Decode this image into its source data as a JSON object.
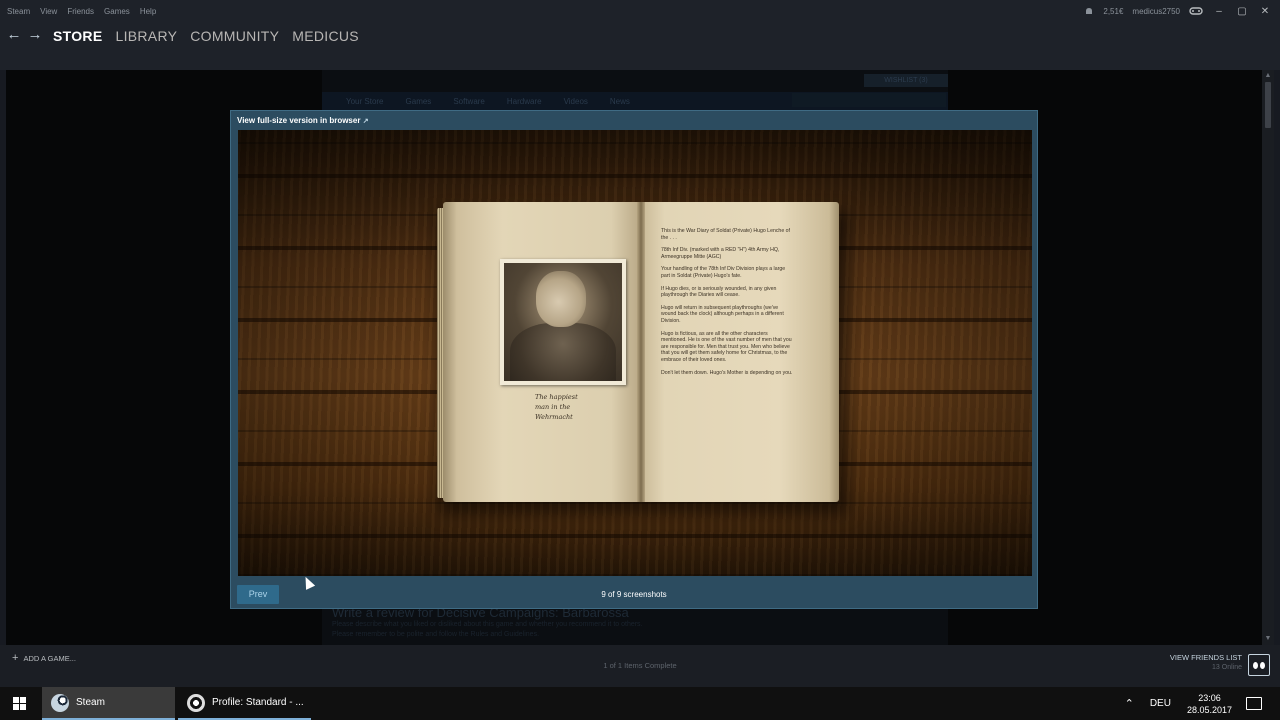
{
  "menu": {
    "items": [
      "Steam",
      "View",
      "Friends",
      "Games",
      "Help"
    ],
    "wallet": "2,51€",
    "username": "medicus2750"
  },
  "nav": {
    "back": "←",
    "forward": "→",
    "store": "STORE",
    "library": "LIBRARY",
    "community": "COMMUNITY",
    "profile": "MEDICUS"
  },
  "store_bg": {
    "nav_items": [
      "Your Store",
      "Games",
      "Software",
      "Hardware",
      "Videos",
      "News"
    ],
    "wishlist": "WISHLIST (3)",
    "review_title": "Write a review for Decisive Campaigns: Barbarossa",
    "review_text1": "Please describe what you liked or disliked about this game and whether you recommend it to others.",
    "review_text2": "Please remember to be polite and follow the Rules and Guidelines."
  },
  "modal": {
    "view_full": "View full-size version in browser",
    "ext_icon": "↗",
    "prev": "Prev",
    "counter": "9 of 9 screenshots",
    "caption": [
      "The happiest",
      "man in the",
      "Wehrmacht"
    ],
    "diary": [
      "This is the War Diary of Soldat (Private) Hugo Lenche of the . . .",
      "78th Inf Div. (marked with a RED \"H\") 4th Army HQ, Armeegruppe Mitte (AGC)",
      "Your handling of the 78th Inf Div Division plays a large part in Soldat (Private) Hugo's fate.",
      "If Hugo dies, or is seriously wounded, in any given playthrough the Diaries will cease.",
      "Hugo will return in subsequent playthroughs (we've wound back the clock) although perhaps in a different Division.",
      "Hugo is fictious, as are all the other characters mentioned. He is one of the vast number of men that you are responsible for. Men that trust you. Men who believe that you will get them safely home for Christmas, to the embrace of their loved ones.",
      "Don't let them down. Hugo's Mother is depending on you."
    ]
  },
  "bottom": {
    "add_game": "ADD A GAME...",
    "downloads": "1 of 1 Items Complete",
    "friends_label": "VIEW FRIENDS LIST",
    "friends_online": "13 Online"
  },
  "taskbar": {
    "task1": "Steam",
    "task2": "Profile: Standard - ...",
    "lang": "DEU",
    "time": "23:06",
    "date": "28.05.2017"
  }
}
